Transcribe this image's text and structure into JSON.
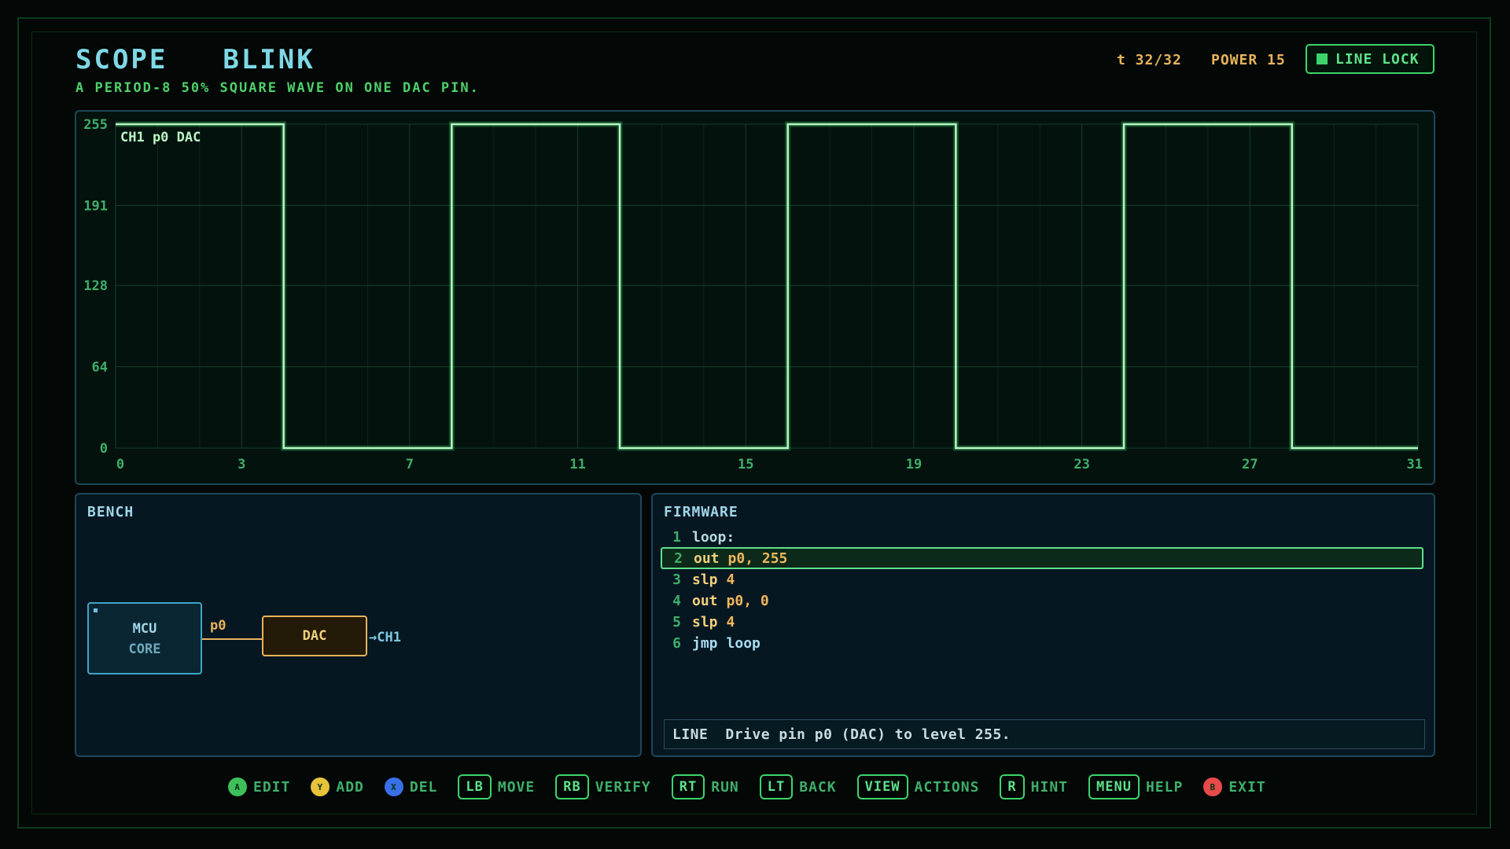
{
  "header": {
    "title_left": "SCOPE",
    "title_right": "BLINK",
    "subtitle": "A PERIOD-8 50% SQUARE WAVE ON ONE DAC PIN.",
    "time": "t 32/32",
    "power": "POWER 15",
    "line_lock": "LINE LOCK"
  },
  "colors": {
    "trace": "#b9f6c3",
    "grid": "#0f3322",
    "accent_green": "#3cd46b",
    "accent_amber": "#e8b35a",
    "panel_border": "#1e4658"
  },
  "scope": {
    "channel_label": "CH1 p0 DAC"
  },
  "chart_data": {
    "type": "line",
    "title": "",
    "series": [
      {
        "name": "CH1 p0 DAC",
        "x": [
          0,
          4,
          4,
          8,
          8,
          12,
          12,
          16,
          16,
          20,
          20,
          24,
          24,
          28,
          28,
          31
        ],
        "y": [
          255,
          255,
          0,
          0,
          255,
          255,
          0,
          0,
          255,
          255,
          0,
          0,
          255,
          255,
          0,
          0
        ]
      }
    ],
    "xlim": [
      0,
      31
    ],
    "ylim": [
      0,
      255
    ],
    "x_ticks": [
      "0",
      "3",
      "7",
      "11",
      "15",
      "19",
      "23",
      "27",
      "31"
    ],
    "x_tick_values": [
      0,
      3,
      7,
      11,
      15,
      19,
      23,
      27,
      31
    ],
    "y_ticks": [
      "0",
      "64",
      "128",
      "191",
      "255"
    ],
    "y_tick_values": [
      0,
      64,
      128,
      191,
      255
    ],
    "grid": true,
    "step": "hold"
  },
  "bench": {
    "title": "BENCH",
    "mcu_line1": "MCU",
    "mcu_line2": "CORE",
    "pin": "p0",
    "dac": "DAC",
    "output": "→CH1"
  },
  "firmware": {
    "title": "FIRMWARE",
    "lines": [
      {
        "num": "1",
        "op": "loop:",
        "args": ""
      },
      {
        "num": "2",
        "op": "out",
        "args": "p0, 255"
      },
      {
        "num": "3",
        "op": "slp",
        "args": "4"
      },
      {
        "num": "4",
        "op": "out",
        "args": "p0, 0"
      },
      {
        "num": "5",
        "op": "slp",
        "args": "4"
      },
      {
        "num": "6",
        "op": "jmp",
        "args": "loop"
      }
    ],
    "status_key": "LINE",
    "status_text": "Drive pin p0 (DAC) to level 255."
  },
  "controls": [
    {
      "key": "A",
      "label": "EDIT",
      "style": "round",
      "color": "#3fbf5a"
    },
    {
      "key": "Y",
      "label": "ADD",
      "style": "round",
      "color": "#e8c23a"
    },
    {
      "key": "X",
      "label": "DEL",
      "style": "round",
      "color": "#3a6fe8"
    },
    {
      "key": "LB",
      "label": "MOVE",
      "style": "key"
    },
    {
      "key": "RB",
      "label": "VERIFY",
      "style": "key"
    },
    {
      "key": "RT",
      "label": "RUN",
      "style": "key"
    },
    {
      "key": "LT",
      "label": "BACK",
      "style": "key"
    },
    {
      "key": "VIEW",
      "label": "ACTIONS",
      "style": "key"
    },
    {
      "key": "R",
      "label": "HINT",
      "style": "key"
    },
    {
      "key": "MENU",
      "label": "HELP",
      "style": "key"
    },
    {
      "key": "B",
      "label": "EXIT",
      "style": "round",
      "color": "#e84a4a"
    }
  ]
}
